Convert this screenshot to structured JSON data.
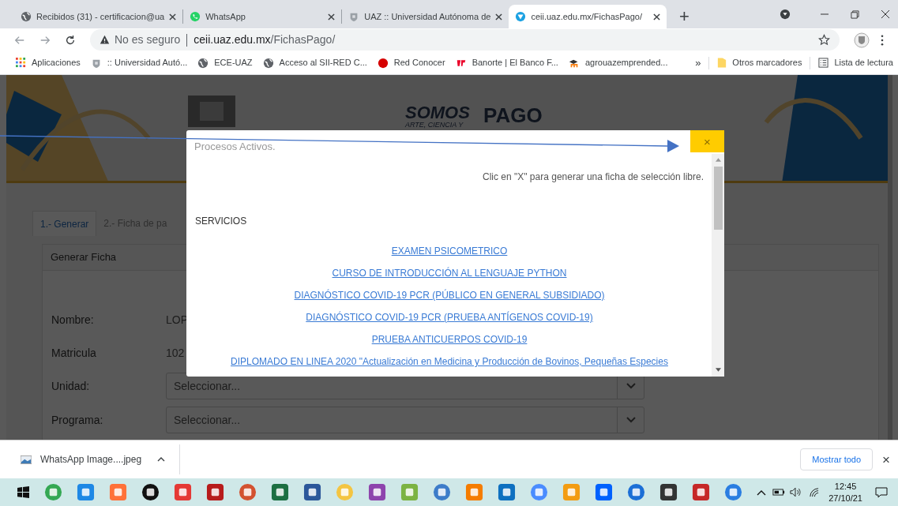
{
  "browser": {
    "tabs": [
      {
        "title": "Recibidos (31) - certificacion@ua",
        "selected": false
      },
      {
        "title": "WhatsApp",
        "selected": false
      },
      {
        "title": "UAZ :: Universidad Autónoma de",
        "selected": false
      },
      {
        "title": "ceii.uaz.edu.mx/FichasPago/",
        "selected": true
      }
    ],
    "new_tab": "+",
    "address": {
      "security": "No es seguro",
      "host": "ceii.uaz.edu.mx",
      "path": "/FichasPago/"
    },
    "bookmarks": [
      {
        "label": "Aplicaciones"
      },
      {
        "label": ":: Universidad Autó..."
      },
      {
        "label": "ECE-UAZ"
      },
      {
        "label": "Acceso al SII-RED C..."
      },
      {
        "label": "Red Conocer"
      },
      {
        "label": "Banorte | El Banco F..."
      },
      {
        "label": "agrouazemprended..."
      }
    ],
    "bookmarks_overflow": "»",
    "other_bookmarks": "Otros marcadores",
    "reading_list": "Lista de lectura"
  },
  "page": {
    "banner": {
      "somos": "SOMOS",
      "tagline": "ARTE, CIENCIA Y",
      "pago": "PAGO"
    },
    "tabs": [
      {
        "label": "1.- Generar",
        "selected": true
      },
      {
        "label": "2.- Ficha de pa",
        "selected": false
      }
    ],
    "panel_title": "Generar Ficha",
    "fields": [
      {
        "label": "Nombre:",
        "kind": "text",
        "value": "LOP"
      },
      {
        "label": "Matricula",
        "kind": "text",
        "value": "102"
      },
      {
        "label": "Unidad:",
        "kind": "select",
        "placeholder": "Seleccionar..."
      },
      {
        "label": "Programa:",
        "kind": "select",
        "placeholder": "Seleccionar..."
      }
    ]
  },
  "modal": {
    "title": "Procesos Activos.",
    "close": "×",
    "hint": "Clic en \"X\" para generar una ficha de selección libre.",
    "section": "SERVICIOS",
    "links": [
      "EXAMEN PSICOMETRICO",
      "CURSO DE INTRODUCCIÓN AL LENGUAJE PYTHON",
      "DIAGNÓSTICO COVID-19 PCR (PÚBLICO EN GENERAL SUBSIDIADO)",
      "DIAGNÓSTICO COVID-19 PCR (PRUEBA ANTÍGENOS COVID-19)",
      "PRUEBA ANTICUERPOS COVID-19",
      "DIPLOMADO EN LINEA 2020 \"Actualización en Medicina y Producción de Bovinos, Pequeñas Especies"
    ]
  },
  "downloads": {
    "file": "WhatsApp Image....jpeg",
    "show_all": "Mostrar todo",
    "close": "×"
  },
  "taskbar": {
    "time": "12:45",
    "date": "27/10/21"
  }
}
